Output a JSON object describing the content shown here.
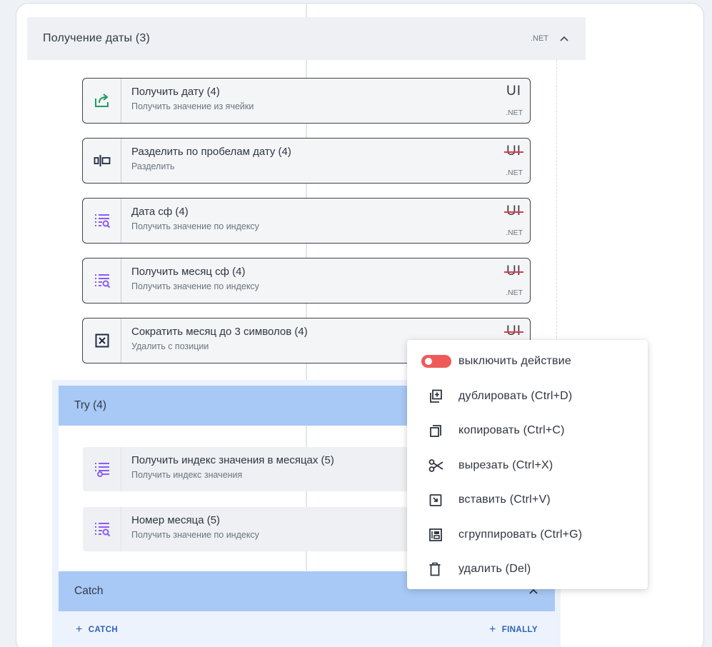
{
  "group": {
    "title": "Получение даты (3)",
    "tag": ".NET"
  },
  "cards": [
    {
      "title": "Получить дату (4)",
      "subtitle": "Получить значение из ячейки",
      "ui": "UI",
      "net": ".NET",
      "icon": "export-icon"
    },
    {
      "title": "Разделить по пробелам дату (4)",
      "subtitle": "Разделить",
      "ui": "UI",
      "net": ".NET",
      "icon": "split-icon"
    },
    {
      "title": "Дата сф (4)",
      "subtitle": "Получить значение по индексу",
      "ui": "UI",
      "net": ".NET",
      "icon": "list-search-icon"
    },
    {
      "title": "Получить месяц сф (4)",
      "subtitle": "Получить значение по индексу",
      "ui": "UI",
      "net": ".NET",
      "icon": "list-search-icon"
    },
    {
      "title": "Сократить месяц до 3 символов (4)",
      "subtitle": "Удалить с позиции",
      "ui": "UI",
      "icon": "remove-box-icon"
    }
  ],
  "try_block": {
    "title": "Try (4)",
    "cards": [
      {
        "title": "Получить индекс значения в месяцах (5)",
        "subtitle": "Получить индекс значения",
        "icon": "list-index-icon"
      },
      {
        "title": "Номер месяца (5)",
        "subtitle": "Получить значение по индексу",
        "icon": "list-search-icon"
      }
    ]
  },
  "catch_block": {
    "title": "Catch",
    "add_catch": "CATCH",
    "add_finally": "FINALLY"
  },
  "context_menu": {
    "items": [
      {
        "label": "выключить действие",
        "icon": "toggle-icon"
      },
      {
        "label": "дублировать (Ctrl+D)",
        "icon": "duplicate-icon"
      },
      {
        "label": "копировать (Ctrl+C)",
        "icon": "copy-icon"
      },
      {
        "label": "вырезать (Ctrl+X)",
        "icon": "scissors-icon"
      },
      {
        "label": "вставить (Ctrl+V)",
        "icon": "paste-icon"
      },
      {
        "label": "сгруппировать (Ctrl+G)",
        "icon": "group-icon"
      },
      {
        "label": "удалить (Del)",
        "icon": "trash-icon"
      }
    ]
  },
  "colors": {
    "accent_green": "#1e9b5f",
    "accent_purple": "#8b5cf6",
    "block_blue": "#a8c8f5",
    "danger_red": "#ee5a5a",
    "link_blue": "#2f62b8"
  }
}
